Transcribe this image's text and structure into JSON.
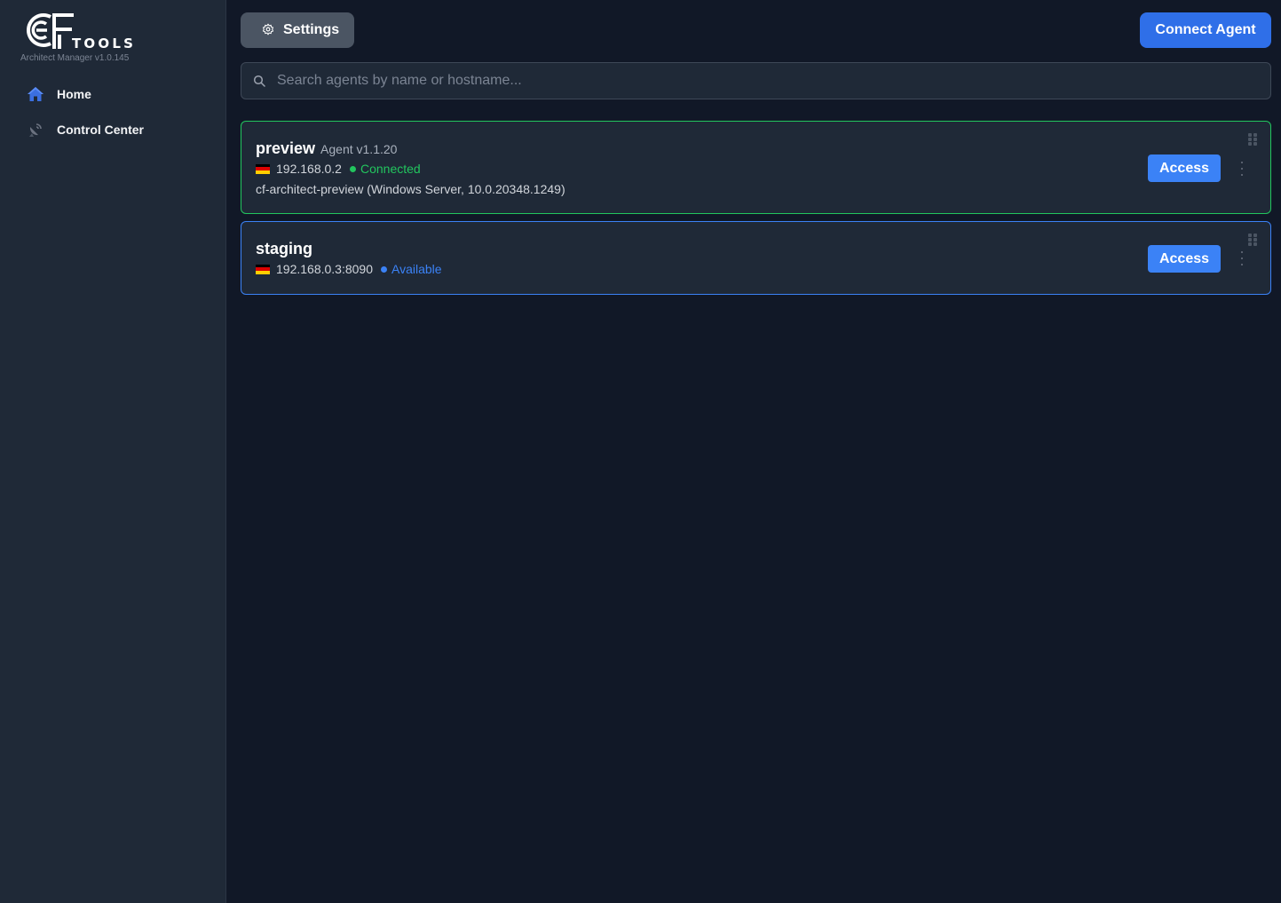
{
  "app": {
    "logo_text": "CF",
    "logo_sub": "TOOLS",
    "version": "Architect Manager v1.0.145"
  },
  "sidebar": {
    "items": [
      {
        "label": "Home",
        "icon": "home-icon",
        "active": true
      },
      {
        "label": "Control Center",
        "icon": "satellite-dish-icon",
        "active": false
      }
    ]
  },
  "header": {
    "settings_label": "Settings",
    "connect_label": "Connect Agent"
  },
  "search": {
    "placeholder": "Search agents by name or hostname...",
    "value": ""
  },
  "agents": [
    {
      "name": "preview",
      "version": "Agent v1.1.20",
      "ip": "192.168.0.2",
      "status": "Connected",
      "host": "cf-architect-preview (Windows Server, 10.0.20348.1249)",
      "access_label": "Access",
      "flag": "DE"
    },
    {
      "name": "staging",
      "version": "",
      "ip": "192.168.0.3:8090",
      "status": "Available",
      "host": "",
      "access_label": "Access",
      "flag": "DE"
    }
  ],
  "colors": {
    "background": "#111827",
    "sidebar": "#1f2937",
    "card": "#1f2937",
    "primary": "#3b82f6",
    "connected": "#22c55e",
    "available": "#3b82f6"
  }
}
